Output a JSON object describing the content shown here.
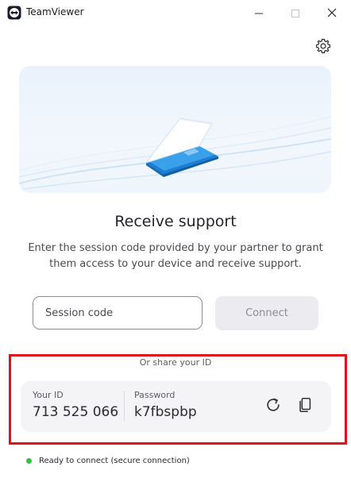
{
  "window": {
    "title": "TeamViewer",
    "controls": [
      "minimize-icon",
      "maximize-icon",
      "close-icon"
    ]
  },
  "header": {
    "settings_icon": "gear-icon"
  },
  "hero": {
    "illustration": "devices-illustration"
  },
  "main": {
    "heading": "Receive support",
    "description": "Enter the session code provided by your partner to grant them access to your device and receive support.",
    "session_placeholder": "Session code",
    "connect_label": "Connect"
  },
  "share": {
    "label": "Or share your ID",
    "id_label": "Your ID",
    "id_value": "713 525 066",
    "password_label": "Password",
    "password_value": "k7fbspbp",
    "refresh_icon": "refresh-icon",
    "copy_icon": "copy-icon"
  },
  "status": {
    "text": "Ready to connect (secure connection)",
    "color": "#34c04b"
  },
  "colors": {
    "highlight": "#e3111b",
    "brand": "#0e8ee9"
  }
}
